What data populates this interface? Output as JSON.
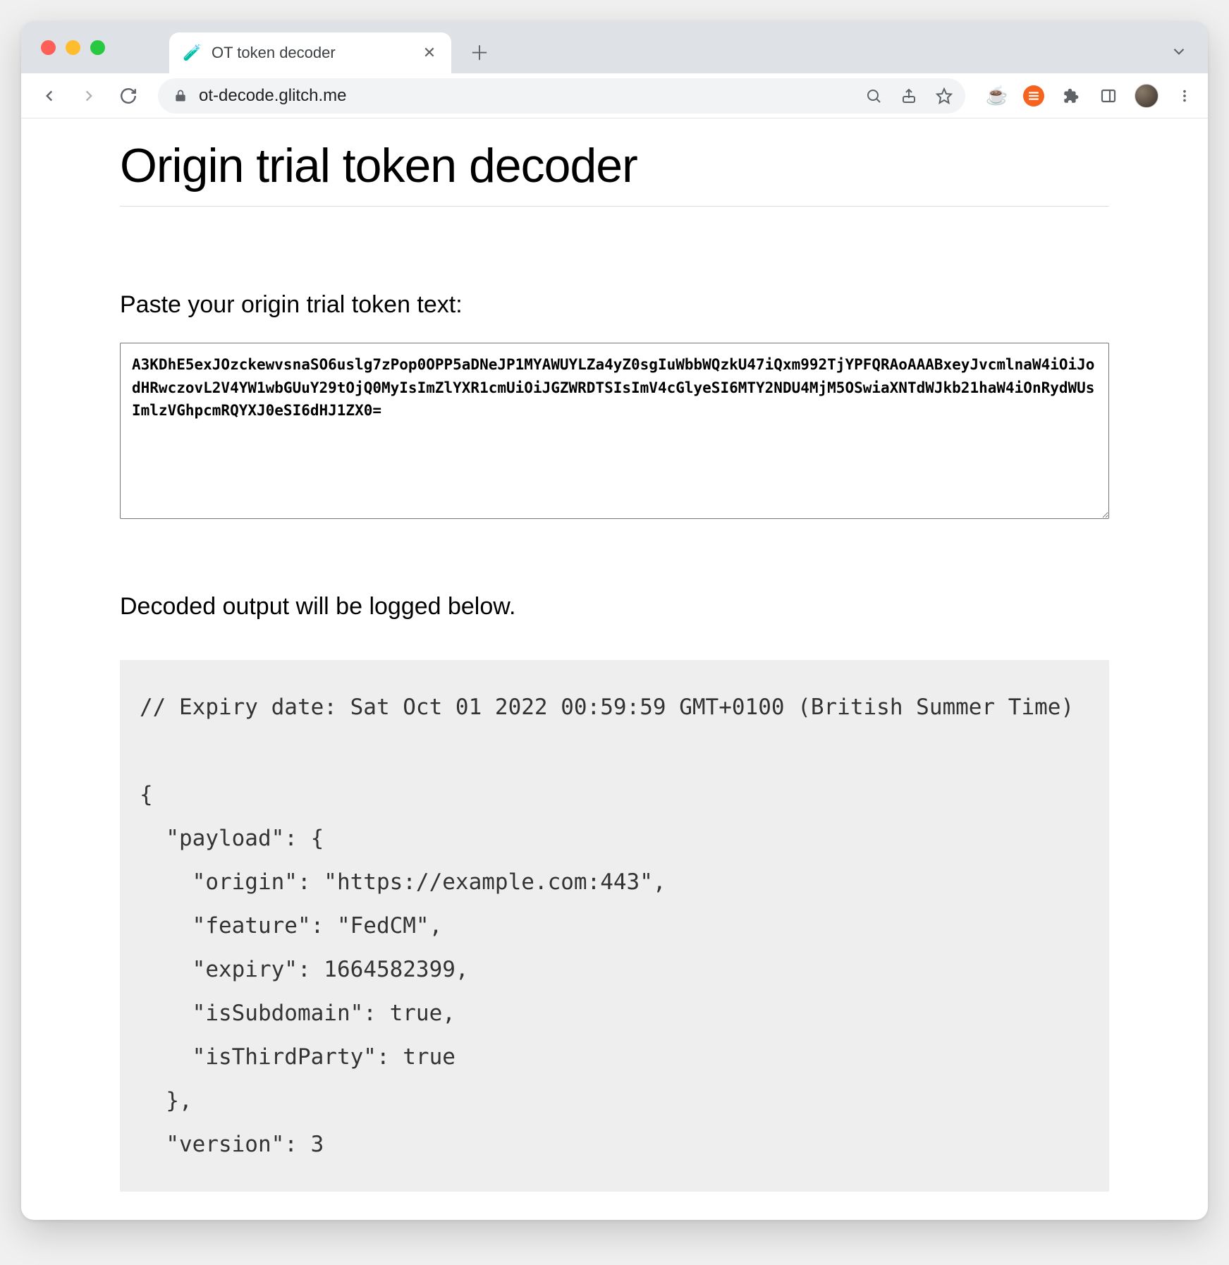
{
  "browser": {
    "tab_title": "OT token decoder",
    "favicon_glyph": "🧪",
    "url_display": "ot-decode.glitch.me"
  },
  "page": {
    "title": "Origin trial token decoder",
    "input_label": "Paste your origin trial token text:",
    "token_value": "A3KDhE5exJOzckewvsnaSO6uslg7zPop0OPP5aDNeJP1MYAWUYLZa4yZ0sgIuWbbWQzkU47iQxm992TjYPFQRAoAAABxeyJvcmlnaW4iOiJodHRwczovL2V4YW1wbGUuY29tOjQ0MyIsImZlYXR1cmUiOiJGZWRDTSIsImV4cGlyeSI6MTY2NDU4MjM5OSwiaXNTdWJkb21haW4iOnRydWUsImlzVGhpcmRQYXJ0eSI6dHJ1ZX0=",
    "output_label": "Decoded output will be logged below.",
    "output_text": "// Expiry date: Sat Oct 01 2022 00:59:59 GMT+0100 (British Summer Time)\n\n{\n  \"payload\": {\n    \"origin\": \"https://example.com:443\",\n    \"feature\": \"FedCM\",\n    \"expiry\": 1664582399,\n    \"isSubdomain\": true,\n    \"isThirdParty\": true\n  },\n  \"version\": 3"
  }
}
